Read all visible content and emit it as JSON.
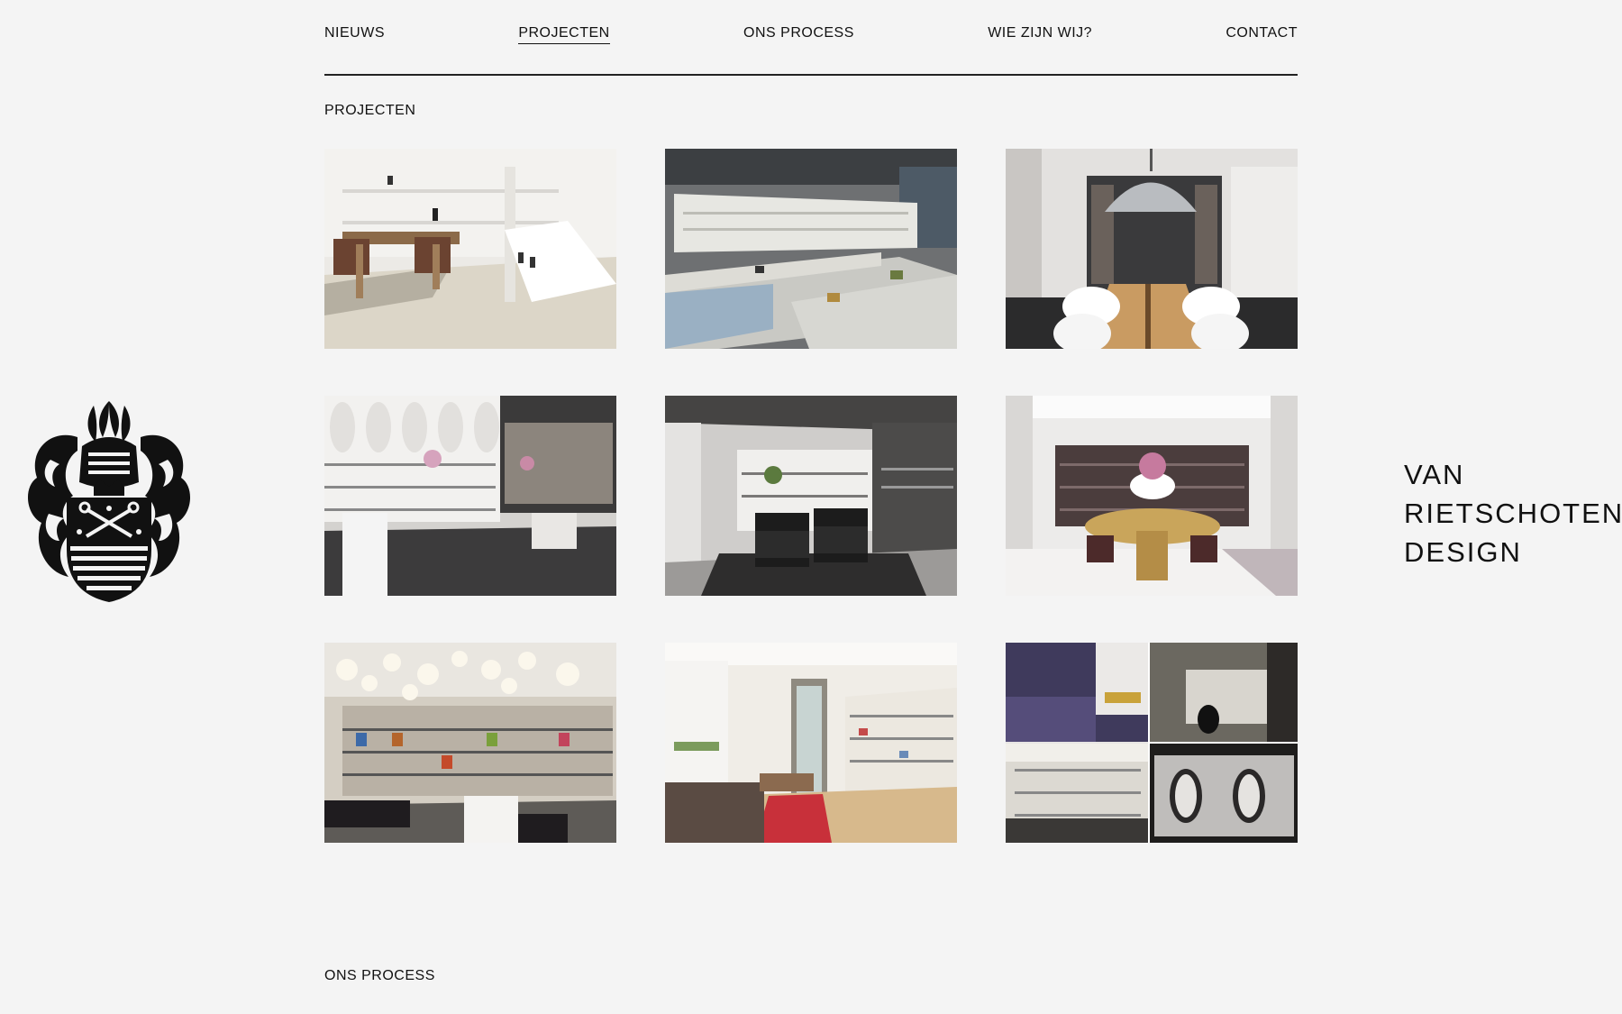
{
  "nav": {
    "items": [
      {
        "label": "NIEUWS",
        "active": false
      },
      {
        "label": "PROJECTEN",
        "active": true
      },
      {
        "label": "ONS PROCESS",
        "active": false
      },
      {
        "label": "WIE ZIJN WIJ?",
        "active": false
      },
      {
        "label": "CONTACT",
        "active": false
      }
    ]
  },
  "projects": {
    "title": "PROJECTEN"
  },
  "next_section": {
    "title": "ONS PROCESS"
  },
  "brand": {
    "lines": [
      "VAN",
      "RIETSCHOTEN",
      "DESIGN"
    ]
  },
  "colors": {
    "background": "#f4f4f4",
    "text": "#111111"
  }
}
